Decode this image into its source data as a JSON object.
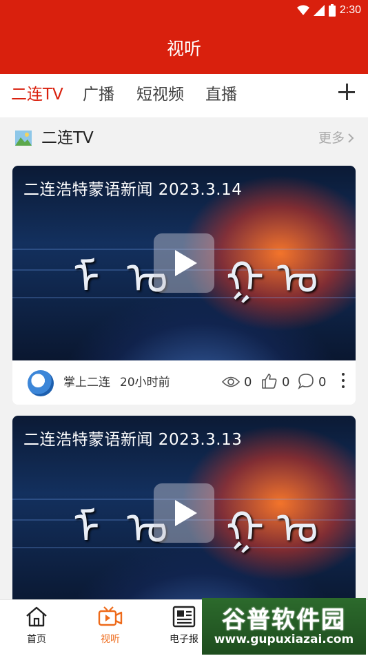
{
  "status_bar": {
    "time": "2:30"
  },
  "header": {
    "title": "视听"
  },
  "tabs": [
    {
      "label": "二连TV",
      "active": true
    },
    {
      "label": "广播",
      "active": false
    },
    {
      "label": "短视频",
      "active": false
    },
    {
      "label": "直播",
      "active": false
    }
  ],
  "section": {
    "title": "二连TV",
    "more_label": "更多"
  },
  "videos": [
    {
      "title": "二连浩特蒙语新闻 2023.3.14",
      "source": "掌上二连",
      "time": "20小时前",
      "views": "0",
      "likes": "0",
      "comments": "0"
    },
    {
      "title": "二连浩特蒙语新闻 2023.3.13"
    }
  ],
  "bottom_nav": [
    {
      "label": "首页",
      "icon": "home-icon"
    },
    {
      "label": "视听",
      "icon": "video-icon",
      "active": true
    },
    {
      "label": "电子报",
      "icon": "newspaper-icon"
    }
  ],
  "watermark": {
    "title": "谷普软件园",
    "url": "www.gupuxiazai.com"
  },
  "colors": {
    "brand_red": "#d9200d",
    "active_orange": "#ee6a1a"
  }
}
